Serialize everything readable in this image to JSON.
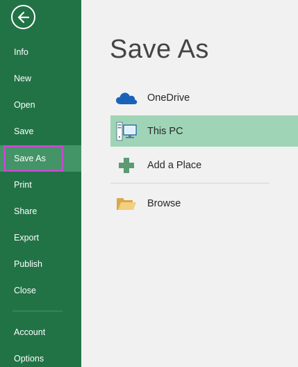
{
  "sidebar": {
    "back_icon": "back-arrow-icon",
    "items": [
      {
        "label": "Info",
        "active": false
      },
      {
        "label": "New",
        "active": false
      },
      {
        "label": "Open",
        "active": false
      },
      {
        "label": "Save",
        "active": false
      },
      {
        "label": "Save As",
        "active": true
      },
      {
        "label": "Print",
        "active": false
      },
      {
        "label": "Share",
        "active": false
      },
      {
        "label": "Export",
        "active": false
      },
      {
        "label": "Publish",
        "active": false
      },
      {
        "label": "Close",
        "active": false
      }
    ],
    "bottom_items": [
      {
        "label": "Account"
      },
      {
        "label": "Options"
      }
    ]
  },
  "main": {
    "title": "Save As",
    "places": [
      {
        "label": "OneDrive",
        "icon": "cloud-icon",
        "selected": false
      },
      {
        "label": "This PC",
        "icon": "computer-icon",
        "selected": true
      },
      {
        "label": "Add a Place",
        "icon": "plus-icon",
        "selected": false
      },
      {
        "label": "Browse",
        "icon": "folder-icon",
        "selected": false
      }
    ]
  },
  "colors": {
    "sidebar_bg": "#217346",
    "sidebar_active": "#439467",
    "selected_place": "#9fd5b6",
    "highlight_box": "#c54ad0",
    "page_bg": "#f1f1f1"
  }
}
